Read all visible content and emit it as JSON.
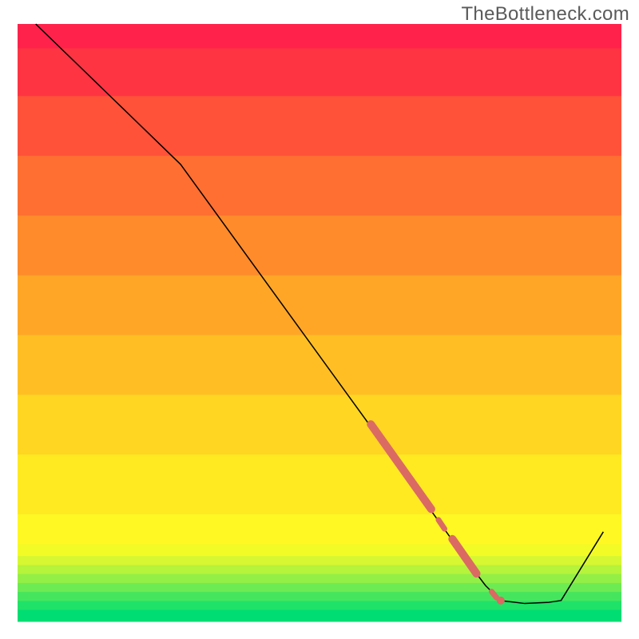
{
  "watermark": "TheBottleneck.com",
  "chart_data": {
    "type": "line",
    "title": "",
    "xlabel": "",
    "ylabel": "",
    "xlim": [
      0,
      100
    ],
    "ylim": [
      0,
      100
    ],
    "axes_visible": false,
    "grid": false,
    "annotations": [],
    "series": [
      {
        "name": "bottleneck-curve",
        "color": "#000000",
        "stroke_width": 1.5,
        "x": [
          3,
          27,
          60,
          62,
          64.5,
          67,
          68.5,
          71,
          74.5,
          77.5,
          80,
          84,
          88,
          90,
          97
        ],
        "y": [
          100,
          76.5,
          30.5,
          27.5,
          24,
          20.5,
          18.5,
          15,
          10,
          6,
          3.5,
          3,
          3.2,
          3.5,
          15
        ]
      }
    ],
    "heat_bands": [
      {
        "color": "#00de73",
        "y0": 0.0,
        "y1": 2.0
      },
      {
        "color": "#1fe269",
        "y0": 2.0,
        "y1": 3.5
      },
      {
        "color": "#45e65e",
        "y0": 3.5,
        "y1": 5.0
      },
      {
        "color": "#6deb52",
        "y0": 5.0,
        "y1": 6.5
      },
      {
        "color": "#93ef46",
        "y0": 6.5,
        "y1": 8.0
      },
      {
        "color": "#b6f33b",
        "y0": 8.0,
        "y1": 9.5
      },
      {
        "color": "#d6f731",
        "y0": 9.5,
        "y1": 11.0
      },
      {
        "color": "#f3fb27",
        "y0": 11.0,
        "y1": 13.0
      },
      {
        "color": "#fff823",
        "y0": 13.0,
        "y1": 18.0
      },
      {
        "color": "#ffea22",
        "y0": 18.0,
        "y1": 28.0
      },
      {
        "color": "#ffd622",
        "y0": 28.0,
        "y1": 38.0
      },
      {
        "color": "#ffbf24",
        "y0": 38.0,
        "y1": 48.0
      },
      {
        "color": "#ffa627",
        "y0": 48.0,
        "y1": 58.0
      },
      {
        "color": "#ff8b2b",
        "y0": 58.0,
        "y1": 68.0
      },
      {
        "color": "#ff6f31",
        "y0": 68.0,
        "y1": 78.0
      },
      {
        "color": "#ff5239",
        "y0": 78.0,
        "y1": 88.0
      },
      {
        "color": "#ff3443",
        "y0": 88.0,
        "y1": 96.0
      },
      {
        "color": "#ff234b",
        "y0": 96.0,
        "y1": 100.0
      }
    ],
    "highlight_segments": [
      {
        "name": "thick-seg-upper",
        "color": "#db6a63",
        "width": 10,
        "cap": "round",
        "x": [
          58.5,
          68.5
        ],
        "y": [
          33.0,
          18.8
        ]
      },
      {
        "name": "dot-mid-1",
        "color": "#db6a63",
        "width": 7,
        "cap": "round",
        "x": [
          69.7,
          70.7
        ],
        "y": [
          17.0,
          15.5
        ]
      },
      {
        "name": "thick-seg-lower",
        "color": "#db6a63",
        "width": 10,
        "cap": "round",
        "x": [
          72.0,
          76.0
        ],
        "y": [
          13.8,
          8.0
        ]
      },
      {
        "name": "dot-low-1",
        "color": "#db6a63",
        "width": 7,
        "cap": "round",
        "x": [
          78.5,
          79.3
        ],
        "y": [
          5.0,
          4.0
        ]
      },
      {
        "name": "end-dot",
        "color": "#db6a63",
        "r": 5,
        "type": "dot",
        "x": [
          80.0
        ],
        "y": [
          3.5
        ]
      }
    ],
    "description": "A bottleneck curve over a vertical red→yellow→green heat gradient. The black curve descends from top-left, has pink/salmon highlighted segments in the lower-right region, reaches a minimum near x≈86 at the green band, then rises toward the right edge."
  }
}
